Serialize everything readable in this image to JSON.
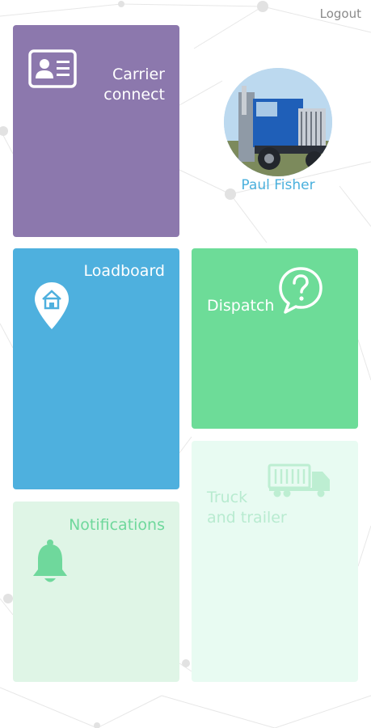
{
  "header": {
    "logout_label": "Logout"
  },
  "profile": {
    "name": "Paul Fisher"
  },
  "tiles": {
    "carrier_connect": {
      "label_line1": "Carrier",
      "label_line2": "connect",
      "icon": "id-card-icon",
      "color": "#8c78ad"
    },
    "loadboard": {
      "label": "Loadboard",
      "icon": "home-pin-icon",
      "color": "#4eb0de"
    },
    "dispatch": {
      "label": "Dispatch",
      "icon": "question-bubble-icon",
      "color": "#6ddc98"
    },
    "notifications": {
      "label": "Notifications",
      "icon": "bell-icon",
      "color": "#dff5e6"
    },
    "truck_and_trailer": {
      "label_line1": "Truck",
      "label_line2": "and trailer",
      "icon": "truck-icon",
      "color": "#e8fbf2"
    }
  }
}
